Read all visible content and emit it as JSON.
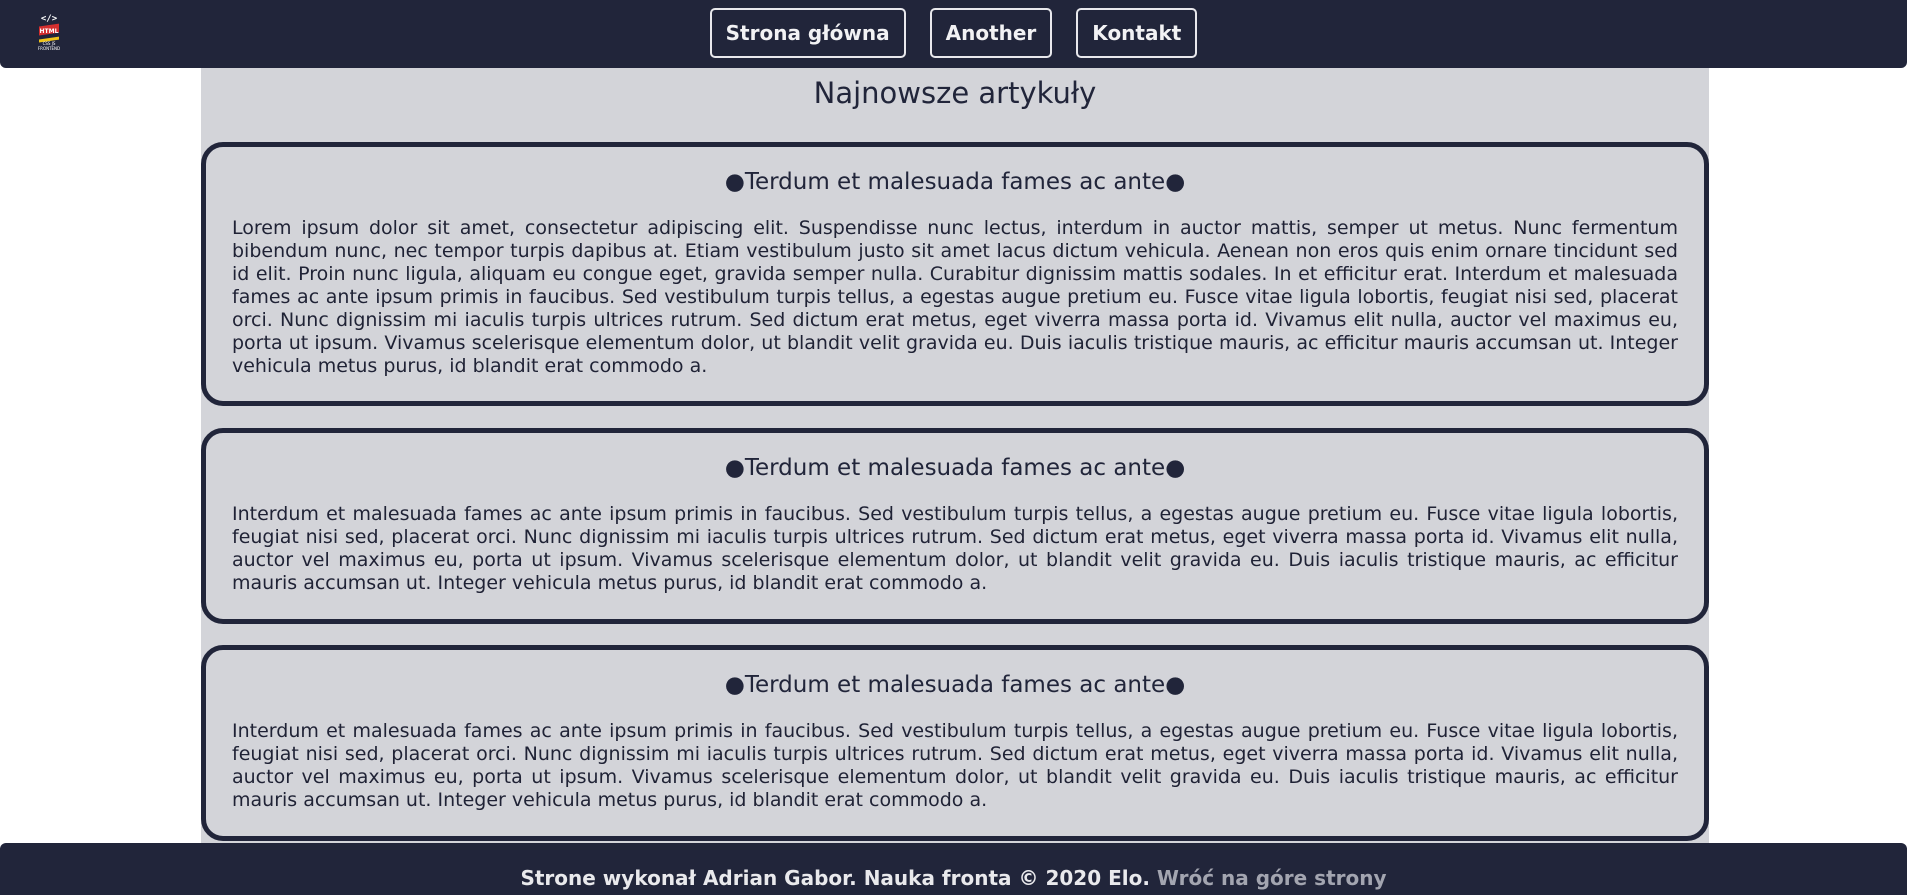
{
  "header": {
    "logo_icon": "html-css-js-logo-icon",
    "nav": [
      {
        "label": "Strona główna"
      },
      {
        "label": "Another"
      },
      {
        "label": "Kontakt"
      }
    ]
  },
  "main": {
    "title": "Najnowsze artykuły",
    "articles": [
      {
        "title": "●Terdum et malesuada fames ac ante●",
        "body": "Lorem ipsum dolor sit amet, consectetur adipiscing elit. Suspendisse nunc lectus, interdum in auctor mattis, semper ut metus. Nunc fermentum bibendum nunc, nec tempor turpis dapibus at. Etiam vestibulum justo sit amet lacus dictum vehicula. Aenean non eros quis enim ornare tincidunt sed id elit. Proin nunc ligula, aliquam eu congue eget, gravida semper nulla. Curabitur dignissim mattis sodales. In et efficitur erat. Interdum et malesuada fames ac ante ipsum primis in faucibus. Sed vestibulum turpis tellus, a egestas augue pretium eu. Fusce vitae ligula lobortis, feugiat nisi sed, placerat orci. Nunc dignissim mi iaculis turpis ultrices rutrum. Sed dictum erat metus, eget viverra massa porta id. Vivamus elit nulla, auctor vel maximus eu, porta ut ipsum. Vivamus scelerisque elementum dolor, ut blandit velit gravida eu. Duis iaculis tristique mauris, ac efficitur mauris accumsan ut. Integer vehicula metus purus, id blandit erat commodo a."
      },
      {
        "title": "●Terdum et malesuada fames ac ante●",
        "body": "Interdum et malesuada fames ac ante ipsum primis in faucibus. Sed vestibulum turpis tellus, a egestas augue pretium eu. Fusce vitae ligula lobortis, feugiat nisi sed, placerat orci. Nunc dignissim mi iaculis turpis ultrices rutrum. Sed dictum erat metus, eget viverra massa porta id. Vivamus elit nulla, auctor vel maximus eu, porta ut ipsum. Vivamus scelerisque elementum dolor, ut blandit velit gravida eu. Duis iaculis tristique mauris, ac efficitur mauris accumsan ut. Integer vehicula metus purus, id blandit erat commodo a."
      },
      {
        "title": "●Terdum et malesuada fames ac ante●",
        "body": "Interdum et malesuada fames ac ante ipsum primis in faucibus. Sed vestibulum turpis tellus, a egestas augue pretium eu. Fusce vitae ligula lobortis, feugiat nisi sed, placerat orci. Nunc dignissim mi iaculis turpis ultrices rutrum. Sed dictum erat metus, eget viverra massa porta id. Vivamus elit nulla, auctor vel maximus eu, porta ut ipsum. Vivamus scelerisque elementum dolor, ut blandit velit gravida eu. Duis iaculis tristique mauris, ac efficitur mauris accumsan ut. Integer vehicula metus purus, id blandit erat commodo a."
      }
    ]
  },
  "footer": {
    "text": "Strone wykonał Adrian Gabor. Nauka fronta © 2020 Elo.",
    "link": "Wróć na góre strony"
  },
  "colors": {
    "dark": "#21253a",
    "panel": "#d3d4d9",
    "link": "#a3a5b0"
  }
}
